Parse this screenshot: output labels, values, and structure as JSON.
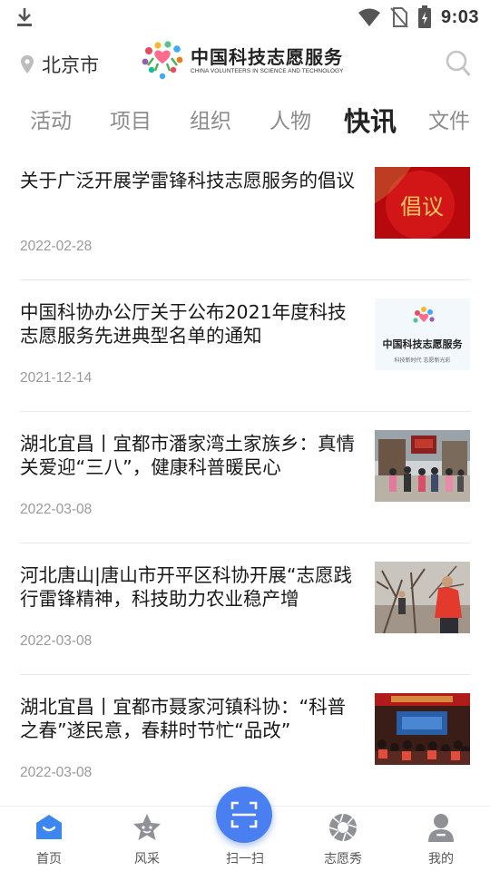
{
  "status_bar": {
    "time": "9:03",
    "icons": [
      "download-icon",
      "wifi-icon",
      "no-sim-icon",
      "battery-charging-icon"
    ]
  },
  "header": {
    "location": "北京市",
    "logo_cn": "中国科技志愿服务",
    "logo_en": "CHINA VOLUNTEERS IN SCIENCE AND TECHNOLOGY",
    "icons": [
      "location-pin-icon",
      "search-icon"
    ]
  },
  "tabs": [
    {
      "label": "活动",
      "active": false
    },
    {
      "label": "项目",
      "active": false
    },
    {
      "label": "组织",
      "active": false
    },
    {
      "label": "人物",
      "active": false
    },
    {
      "label": "快讯",
      "active": true
    },
    {
      "label": "文件",
      "active": false
    }
  ],
  "news": [
    {
      "title": "关于广泛开展学雷锋科技志愿服务的倡议",
      "date": "2022-02-28",
      "thumb_text": "倡议"
    },
    {
      "title": "中国科协办公厅关于公布2021年度科技志愿服务先进典型名单的通知",
      "date": "2021-12-14",
      "thumb_text": "中国科技志愿服务",
      "thumb_sub": "科技新时代 志愿新光彩"
    },
    {
      "title": "湖北宜昌丨宜都市潘家湾土家族乡：真情关爱迎“三八”，健康科普暖民心",
      "date": "2022-03-08"
    },
    {
      "title": "河北唐山|唐山市开平区科协开展“志愿践行雷锋精神，科技助力农业稳产增",
      "date": "2022-03-08"
    },
    {
      "title": "湖北宜昌丨宜都市聂家河镇科协：“科普之春”遂民意，春耕时节忙“品改”",
      "date": "2022-03-08"
    }
  ],
  "bottom_nav": [
    {
      "label": "首页",
      "icon": "home-icon",
      "active": true
    },
    {
      "label": "风采",
      "icon": "star-icon",
      "active": false
    },
    {
      "label": "扫一扫",
      "icon": "scan-icon",
      "active": false
    },
    {
      "label": "志愿秀",
      "icon": "camera-shutter-icon",
      "active": false
    },
    {
      "label": "我的",
      "icon": "user-icon",
      "active": false
    }
  ],
  "colors": {
    "accent": "#4a7ff2",
    "active_tab": "#222222",
    "inactive_tab": "#8c8c8c",
    "date": "#9a9a9a"
  }
}
